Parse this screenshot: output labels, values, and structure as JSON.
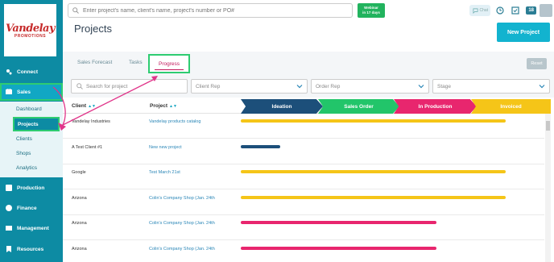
{
  "logo": {
    "main": "Vandelay",
    "sub": "PROMOTIONS"
  },
  "sidebar": {
    "items": [
      {
        "label": "Connect",
        "icon": "connect-icon"
      },
      {
        "label": "Sales",
        "icon": "sales-icon"
      },
      {
        "label": "Production",
        "icon": "production-icon"
      },
      {
        "label": "Finance",
        "icon": "finance-icon"
      },
      {
        "label": "Management",
        "icon": "management-icon"
      },
      {
        "label": "Resources",
        "icon": "resources-icon"
      }
    ],
    "sub_items": [
      "Dashboard",
      "Projects",
      "Clients",
      "Shops",
      "Analytics"
    ]
  },
  "header": {
    "search_placeholder": "Enter project's name, client's name, project's number or PO#",
    "webinar_label": "Webinar",
    "webinar_sub": "in 17 days",
    "chat_label": "Chat",
    "badge_count": "18"
  },
  "page": {
    "title": "Projects",
    "new_button": "New Project"
  },
  "tabs": [
    "Sales Forecast",
    "Tasks",
    "Progress"
  ],
  "reset_label": "Reset",
  "filters": {
    "search_placeholder": "Search for project",
    "client_rep": "Client Rep",
    "order_rep": "Order Rep",
    "stage": "Stage"
  },
  "table": {
    "headers": {
      "client": "Client",
      "project": "Project"
    },
    "stages": [
      {
        "label": "Ideation",
        "color": "#1c4f7a"
      },
      {
        "label": "Sales Order",
        "color": "#22c56a"
      },
      {
        "label": "In Production",
        "color": "#e8266e"
      },
      {
        "label": "Invoiced",
        "color": "#f5c518"
      }
    ],
    "rows": [
      {
        "client": "Vandelay Industries",
        "project": "Vandelay products catalog",
        "progress": 1.0,
        "color": "#f5c518"
      },
      {
        "client": "A Test Client #1",
        "project": "New new project",
        "progress": 0.15,
        "color": "#1c4f7a"
      },
      {
        "client": "Google",
        "project": "Test March 21st",
        "progress": 1.0,
        "color": "#f5c518"
      },
      {
        "client": "Arizona",
        "project": "Colin's Company Shop (Jan. 24th",
        "progress": 1.0,
        "color": "#f5c518"
      },
      {
        "client": "Arizona",
        "project": "Colin's Company Shop (Jan. 24th",
        "progress": 0.74,
        "color": "#e8266e"
      },
      {
        "client": "Arizona",
        "project": "Colin's Company Shop (Jan. 24th",
        "progress": 0.74,
        "color": "#e8266e"
      }
    ]
  }
}
